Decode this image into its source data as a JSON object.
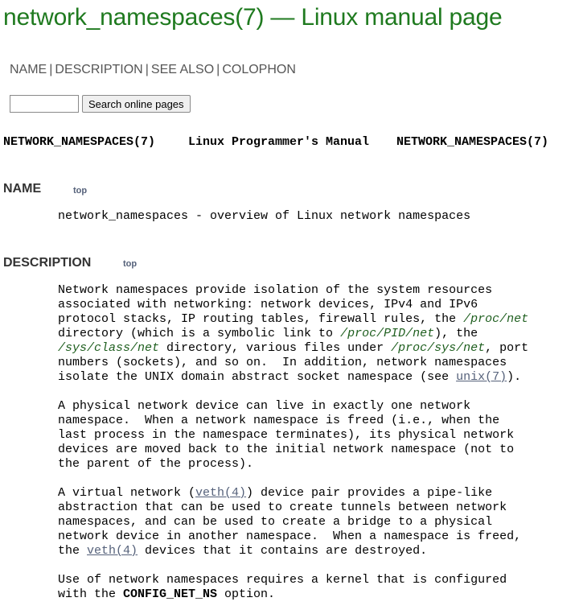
{
  "page": {
    "title": "network_namespaces(7) — Linux manual page"
  },
  "nav": {
    "items": [
      {
        "label": "NAME"
      },
      {
        "label": "DESCRIPTION"
      },
      {
        "label": "SEE ALSO"
      },
      {
        "label": "COLOPHON"
      }
    ],
    "separator": "|"
  },
  "search": {
    "value": "",
    "button_label": "Search online pages"
  },
  "header": {
    "left": "NETWORK_NAMESPACES(7)",
    "center": "Linux Programmer's Manual",
    "right": "NETWORK_NAMESPACES(7)"
  },
  "sections": {
    "name": {
      "heading": "NAME",
      "top_label": "top",
      "text": "network_namespaces - overview of Linux network namespaces"
    },
    "description": {
      "heading": "DESCRIPTION",
      "top_label": "top",
      "p1": {
        "t1": "Network namespaces provide isolation of the system resources\nassociated with networking: network devices, IPv4 and IPv6\nprotocol stacks, IP routing tables, firewall rules, the ",
        "path1": "/proc/net",
        "t2": "\ndirectory (which is a symbolic link to ",
        "path2": "/proc/PID/net",
        "t3": "), the\n",
        "path3": "/sys/class/net",
        "t4": " directory, various files under ",
        "path4": "/proc/sys/net",
        "t5": ", port\nnumbers (sockets), and so on.  In addition, network namespaces\nisolate the UNIX domain abstract socket namespace (see ",
        "ref1": "unix(7)",
        "t6": ")."
      },
      "p2": "A physical network device can live in exactly one network\nnamespace.  When a network namespace is freed (i.e., when the\nlast process in the namespace terminates), its physical network\ndevices are moved back to the initial network namespace (not to\nthe parent of the process).",
      "p3": {
        "t1": "A virtual network (",
        "ref1": "veth(4)",
        "t2": ") device pair provides a pipe-like\nabstraction that can be used to create tunnels between network\nnamespaces, and can be used to create a bridge to a physical\nnetwork device in another namespace.  When a namespace is freed,\nthe ",
        "ref2": "veth(4)",
        "t3": " devices that it contains are destroyed."
      },
      "p4": {
        "t1": "Use of network namespaces requires a kernel that is configured\nwith the ",
        "opt": "CONFIG_NET_NS",
        "t2": " option."
      }
    }
  }
}
